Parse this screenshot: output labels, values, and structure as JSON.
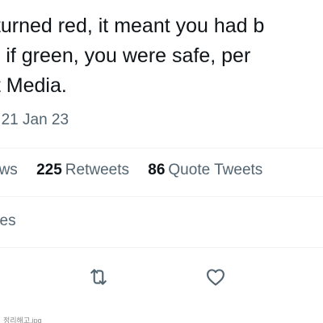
{
  "tweet": {
    "text_lines": [
      "t turned red, it meant you had b",
      "ff. if green, you were safe, per",
      "pt Media."
    ],
    "meta": "· 21 Jan 23"
  },
  "stats": {
    "views_label": "ews",
    "retweets_count": "225",
    "retweets_label": "Retweets",
    "quotes_count": "86",
    "quotes_label": "Quote Tweets"
  },
  "likes": {
    "label": "kes"
  },
  "actions": {
    "retweet_icon": "retweet-icon",
    "like_icon": "heart-icon"
  },
  "watermark": {
    "text": "정리해고.jpg"
  },
  "colors": {
    "text_primary": "#0f1419",
    "text_secondary": "#536471",
    "divider": "#eff3f4"
  }
}
